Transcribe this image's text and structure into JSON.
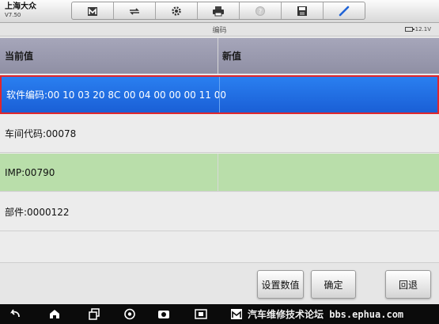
{
  "app": {
    "title": "上海大众",
    "version": "V7.50"
  },
  "toolbar": {
    "icons": [
      "home-icon",
      "vehicle-swap-icon",
      "gear-icon",
      "printer-icon",
      "help-icon",
      "save-icon",
      "edit-icon"
    ]
  },
  "subbar": {
    "title": "编码",
    "battery": "12.1V"
  },
  "table": {
    "headers": {
      "current": "当前值",
      "new": "新值"
    },
    "rows": [
      {
        "current": "软件编码:00 10 03 20 8C 00 04 00 00 00 11 00",
        "new": "",
        "selected": true
      },
      {
        "current": "车间代码:00078",
        "new": ""
      },
      {
        "current": "IMP:00790",
        "new": ""
      },
      {
        "current": "部件:0000122",
        "new": ""
      }
    ]
  },
  "buttons": {
    "set_value": "设置数值",
    "confirm": "确定",
    "back": "回退"
  },
  "navbar": {
    "icons": [
      "back-icon",
      "home-icon",
      "recent-apps-icon",
      "browser-icon",
      "camera-icon",
      "screenshot-icon",
      "launcher-icon"
    ]
  },
  "watermark": "汽车维修技术论坛 bbs.ephua.com",
  "colors": {
    "selected_row": "#1f6fe6",
    "selection_border": "#e0262b",
    "header_bg": "#9b9bb0",
    "green_row": "#b9deaa"
  }
}
